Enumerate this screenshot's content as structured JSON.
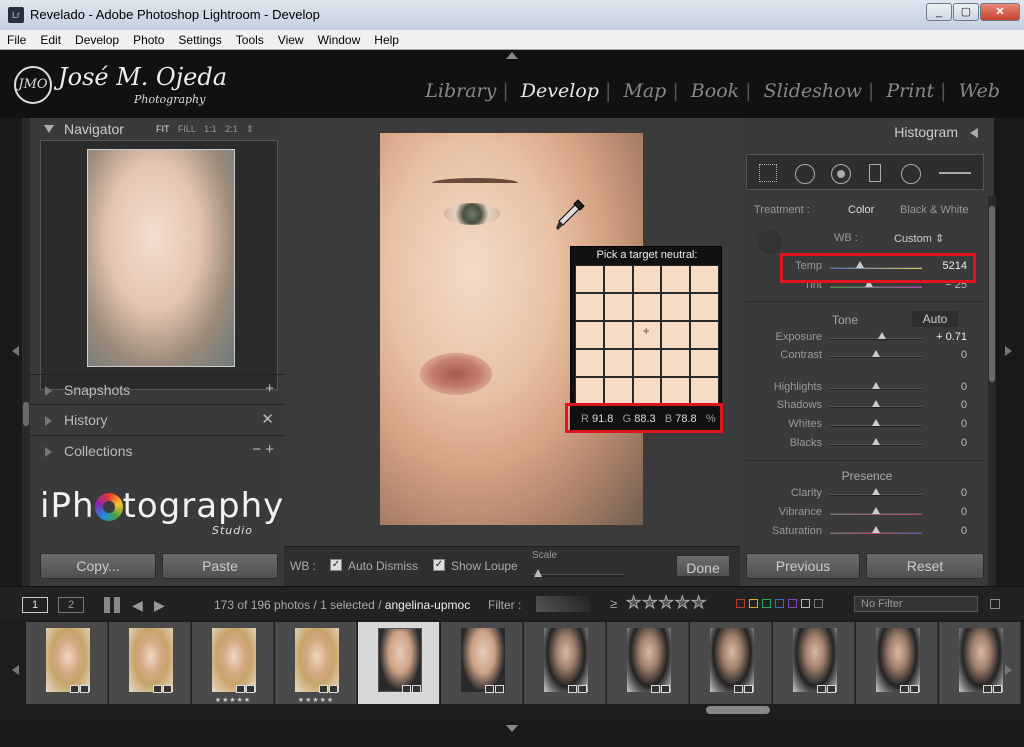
{
  "window": {
    "title": "Revelado - Adobe Photoshop Lightroom - Develop",
    "app_badge": "Lr"
  },
  "window_buttons": {
    "minimize": "_",
    "maximize": "▢",
    "close": "✕"
  },
  "menu": [
    "File",
    "Edit",
    "Develop",
    "Photo",
    "Settings",
    "Tools",
    "View",
    "Window",
    "Help"
  ],
  "brand": {
    "monogram": "JMO",
    "name": "José M. Ojeda",
    "sub": "Photography"
  },
  "modules": [
    {
      "label": "Library",
      "active": false
    },
    {
      "label": "Develop",
      "active": true
    },
    {
      "label": "Map",
      "active": false
    },
    {
      "label": "Book",
      "active": false
    },
    {
      "label": "Slideshow",
      "active": false
    },
    {
      "label": "Print",
      "active": false
    },
    {
      "label": "Web",
      "active": false
    }
  ],
  "navigator": {
    "title": "Navigator",
    "zoom_options": [
      "FIT",
      "FILL",
      "1:1",
      "2:1"
    ],
    "zoom_selected": "FIT"
  },
  "left_sections": [
    {
      "title": "Snapshots",
      "action": "+"
    },
    {
      "title": "History",
      "action": "✕"
    },
    {
      "title": "Collections",
      "action": "− +"
    }
  ],
  "iphotography": {
    "pre": "iPh",
    "post": "tography",
    "studio": "Studio"
  },
  "left_buttons": {
    "copy": "Copy...",
    "paste": "Paste"
  },
  "picker": {
    "header": "Pick a target neutral:",
    "r_label": "R",
    "r_value": "91.8",
    "g_label": "G",
    "g_value": "88.3",
    "b_label": "B",
    "b_value": "78.8",
    "unit": "%"
  },
  "toolbar": {
    "wb_label": "WB :",
    "auto_dismiss": "Auto Dismiss",
    "show_loupe": "Show Loupe",
    "scale_label": "Scale",
    "done": "Done",
    "auto_dismiss_checked": true,
    "show_loupe_checked": true
  },
  "right_panel": {
    "histogram_title": "Histogram",
    "treatment_label": "Treatment :",
    "treatment_color": "Color",
    "treatment_bw": "Black & White",
    "wb_label": "WB :",
    "wb_value": "Custom ⇕",
    "basic": [
      {
        "label": "Temp",
        "value": "5214",
        "level": 0.33
      },
      {
        "label": "Tint",
        "value": "− 25",
        "level": 0.42
      }
    ],
    "tone_label": "Tone",
    "tone_auto": "Auto",
    "tone": [
      {
        "label": "Exposure",
        "value": "+ 0.71",
        "level": 0.56
      },
      {
        "label": "Contrast",
        "value": "0",
        "level": 0.5
      }
    ],
    "tone2": [
      {
        "label": "Highlights",
        "value": "0",
        "level": 0.5
      },
      {
        "label": "Shadows",
        "value": "0",
        "level": 0.5
      },
      {
        "label": "Whites",
        "value": "0",
        "level": 0.5
      },
      {
        "label": "Blacks",
        "value": "0",
        "level": 0.5
      }
    ],
    "presence_label": "Presence",
    "presence": [
      {
        "label": "Clarity",
        "value": "0",
        "level": 0.5
      },
      {
        "label": "Vibrance",
        "value": "0",
        "level": 0.5
      },
      {
        "label": "Saturation",
        "value": "0",
        "level": 0.5
      }
    ],
    "previous": "Previous",
    "reset": "Reset"
  },
  "filmstrip_bar": {
    "page1": "1",
    "page2": "2",
    "count_text": "173 of 196 photos / 1 selected /",
    "filename": "angelina-upmoc",
    "filter_label": "Filter :",
    "rating_op": "≥",
    "stars": "★★★★★",
    "filter_select": "No Filter",
    "color_labels": [
      "#c0392b",
      "#d4ac0d",
      "#27ae60",
      "#2e6fd0",
      "#8e44ad",
      "#bbbbbb",
      "#777777"
    ]
  },
  "thumbnails": [
    {
      "kind": "blonde",
      "stars": "",
      "selected": false
    },
    {
      "kind": "blonde",
      "stars": "",
      "selected": false
    },
    {
      "kind": "blonde",
      "stars": "★★★★★",
      "selected": false
    },
    {
      "kind": "blonde",
      "stars": "★★★★★",
      "selected": false
    },
    {
      "kind": "light",
      "stars": "",
      "selected": true
    },
    {
      "kind": "light",
      "stars": "",
      "selected": false
    },
    {
      "kind": "dark",
      "stars": "",
      "selected": false
    },
    {
      "kind": "dark",
      "stars": "",
      "selected": false
    },
    {
      "kind": "dark",
      "stars": "",
      "selected": false
    },
    {
      "kind": "dark",
      "stars": "",
      "selected": false
    },
    {
      "kind": "dark",
      "stars": "",
      "selected": false
    },
    {
      "kind": "dark",
      "stars": "",
      "selected": false
    }
  ]
}
